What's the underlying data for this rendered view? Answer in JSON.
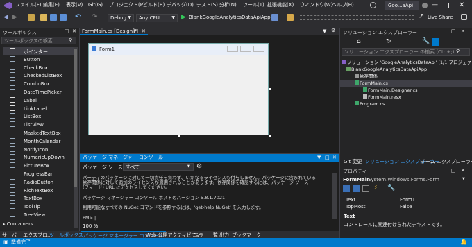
{
  "titlebar": {
    "menus": [
      "ファイル(F)",
      "編集(E)",
      "表示(V)",
      "Git(G)",
      "プロジェクト(P)",
      "ビルド(B)",
      "デバッグ(D)",
      "テスト(S)",
      "分析(N)",
      "ツール(T)",
      "拡張機能(X)",
      "ウィンドウ(W)",
      "ヘルプ(H)"
    ],
    "title": "Goo...aApi",
    "search_icon": "search-icon"
  },
  "toolbar": {
    "config": "Debug",
    "platform": "Any CPU",
    "start_label": "BlankGoogleAnalyticsDataApiApp",
    "live_share": "Live Share"
  },
  "toolbox": {
    "title": "ツールボックス",
    "search_placeholder": "ツールボックスの検索",
    "items": [
      "ポインター",
      "Button",
      "CheckBox",
      "CheckedListBox",
      "ComboBox",
      "DateTimePicker",
      "Label",
      "LinkLabel",
      "ListBox",
      "ListView",
      "MaskedTextBox",
      "MonthCalendar",
      "NotifyIcon",
      "NumericUpDown",
      "PictureBox",
      "ProgressBar",
      "RadioButton",
      "RichTextBox",
      "TextBox",
      "ToolTip",
      "TreeView"
    ],
    "group": "Containers"
  },
  "editor": {
    "tab_label": "FormMain.cs [Design]*",
    "form_title": "Form1"
  },
  "package_console": {
    "title": "パッケージ マネージャー コンソール",
    "source_label": "パッケージ ソース(K):",
    "source_value": "すべて",
    "lines": [
      "パーティのパッケージに対して一切責任を負わず、いかなるライセンスも付与しません。パッケージに含まれている",
      "依存関係に対して追加のライセンスが適用されることがあります。依存関係を確認するには、パッケージ ソース",
      "(フィード) URL にアクセスしてください。",
      "",
      "パッケージ マネージャー コンソール ホストのバージョン 5.8.1.7021",
      "",
      "利用可能なすべての NuGet コマンドを参照するには、'get-help NuGet' を入力します。",
      "",
      "PM> |"
    ],
    "zoom": "100 %"
  },
  "bottom_tabs": [
    "サーバー エクスプロ...",
    "ツールボックス",
    "パッケージ マネージャー コンソール",
    "Web 公開アクティビティ",
    "エラー一覧",
    "出力",
    "ブックマーク"
  ],
  "solution": {
    "title": "ソリューション エクスプローラー",
    "search_placeholder": "ソリューション エクスプローラー の検索 (Ctrl+;)",
    "nodes": [
      "ソリューション 'GoogleAnalyticsDataApi' (1/1 プロジェクト",
      "BlankGoogleAnalyticsDataApiApp",
      "依存関係",
      "FormMain.cs",
      "FormMain.Designer.cs",
      "FormMain.resx",
      "Program.cs"
    ],
    "tabs": [
      "Git 変更",
      "ソリューション エクスプローラー",
      "チーム エクスプローラー"
    ]
  },
  "properties": {
    "title": "プロパティ",
    "object": "FormMain",
    "object_type": "System.Windows.Forms.Form",
    "rows": [
      [
        "Text",
        "Form1"
      ],
      [
        "TopMost",
        "False"
      ]
    ],
    "desc_title": "Text",
    "desc_text": "コントロールに関連付けられたテキストです。"
  },
  "status": {
    "text": "準備完了"
  }
}
